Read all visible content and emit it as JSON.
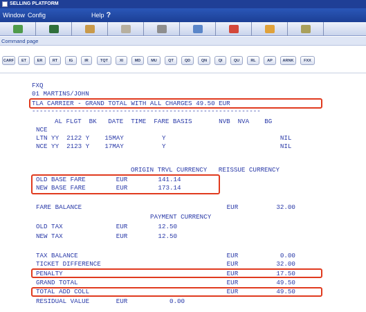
{
  "window": {
    "title": "SELLING PLATFORM"
  },
  "menu": {
    "window": "Window",
    "config": "Config",
    "help": "Help",
    "help_mark": "?"
  },
  "command_bar": {
    "label": "Command page"
  },
  "toolbar": {
    "icons": [
      "notes-icon",
      "terminal-icon",
      "user-icon",
      "calendar-icon",
      "settings-icon",
      "car-icon",
      "person-icon",
      "weather-icon",
      "tools-icon"
    ]
  },
  "function_keys": [
    "CARF",
    "ET",
    "ER",
    "RT",
    "IG",
    "IR",
    "TQT",
    "XI",
    "MD",
    "MU",
    "QT",
    "QD",
    "QN",
    "QI",
    "QU",
    "RL",
    "AP",
    "ARNK",
    "FXX"
  ],
  "screen": {
    "l1": "FXQ",
    "l2": "01 MARTINS/JOHN",
    "l3": "TLA CARRIER - GRAND TOTAL WITH ALL CHARGES 49.50 EUR",
    "dashes": "------------------------------------------------------------",
    "itin_header": "AL FLGT  BK   DATE  TIME  FARE BASIS       NVB  NVA    BG",
    "nce": "NCE",
    "leg1": "LTN YY  2122 Y    15MAY          Y                              NIL",
    "leg2": "NCE YY  2123 Y    17MAY          Y                              NIL",
    "currency_header": "ORIGIN TRVL CURRENCY   REISSUE CURRENCY",
    "old_base": "OLD BASE FARE        EUR        141.14",
    "new_base": "NEW BASE FARE        EUR        173.14",
    "fare_balance": "FARE BALANCE                                      EUR          32.00",
    "payment_header": "PAYMENT CURRENCY",
    "old_tax": "OLD TAX              EUR        12.50",
    "new_tax": "NEW TAX              EUR        12.50",
    "tax_balance": "TAX BALANCE                                       EUR           0.00",
    "ticket_diff": "TICKET DIFFERENCE                                 EUR          32.00",
    "penalty": "PENALTY                                           EUR          17.50",
    "grand_total": "GRAND TOTAL                                       EUR          49.50",
    "total_add": "TOTAL ADD COLL                                    EUR          49.50",
    "residual": "RESIDUAL VALUE       EUR           0.00"
  }
}
